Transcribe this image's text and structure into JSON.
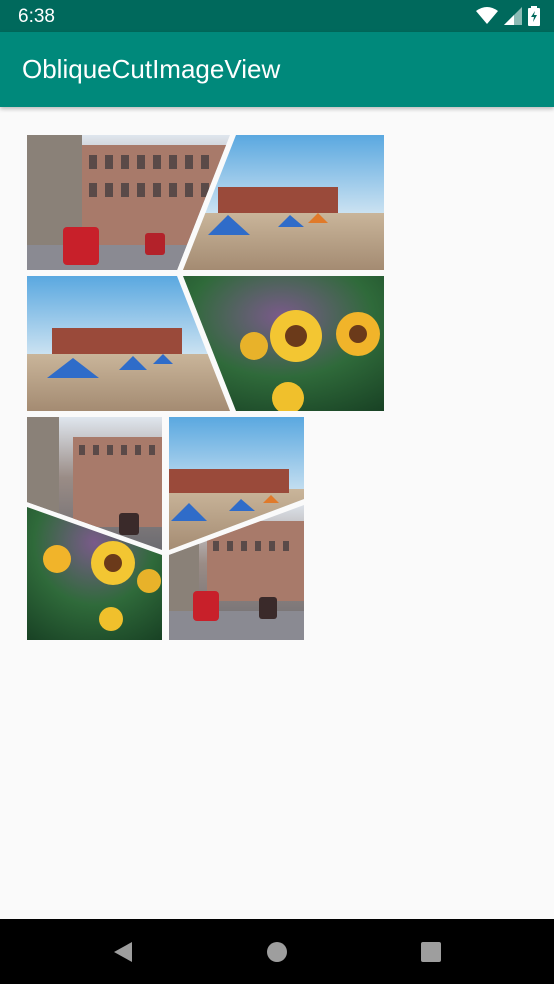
{
  "status_bar": {
    "time": "6:38",
    "icons": [
      "wifi-icon",
      "cell-signal-icon",
      "battery-icon"
    ]
  },
  "app_bar": {
    "title": "ObliqueCutImageView",
    "color": "#00897b",
    "status_color": "#00695c"
  },
  "images": [
    {
      "name": "street",
      "position": "row1-left",
      "cut": "right-oblique"
    },
    {
      "name": "beach",
      "position": "row1-right",
      "cut": "left-oblique"
    },
    {
      "name": "beach",
      "position": "row2-left",
      "cut": "right-oblique"
    },
    {
      "name": "sunflower",
      "position": "row2-right",
      "cut": "left-oblique"
    },
    {
      "name": "street",
      "position": "grid-top-left",
      "cut": "bottom-oblique"
    },
    {
      "name": "sunflower",
      "position": "grid-bottom-left",
      "cut": "top-oblique"
    },
    {
      "name": "beach",
      "position": "grid-top-right",
      "cut": "bottom-oblique"
    },
    {
      "name": "street",
      "position": "grid-bottom-right",
      "cut": "top-oblique"
    }
  ],
  "nav_bar": {
    "buttons": [
      "back-button",
      "home-button",
      "recents-button"
    ]
  }
}
